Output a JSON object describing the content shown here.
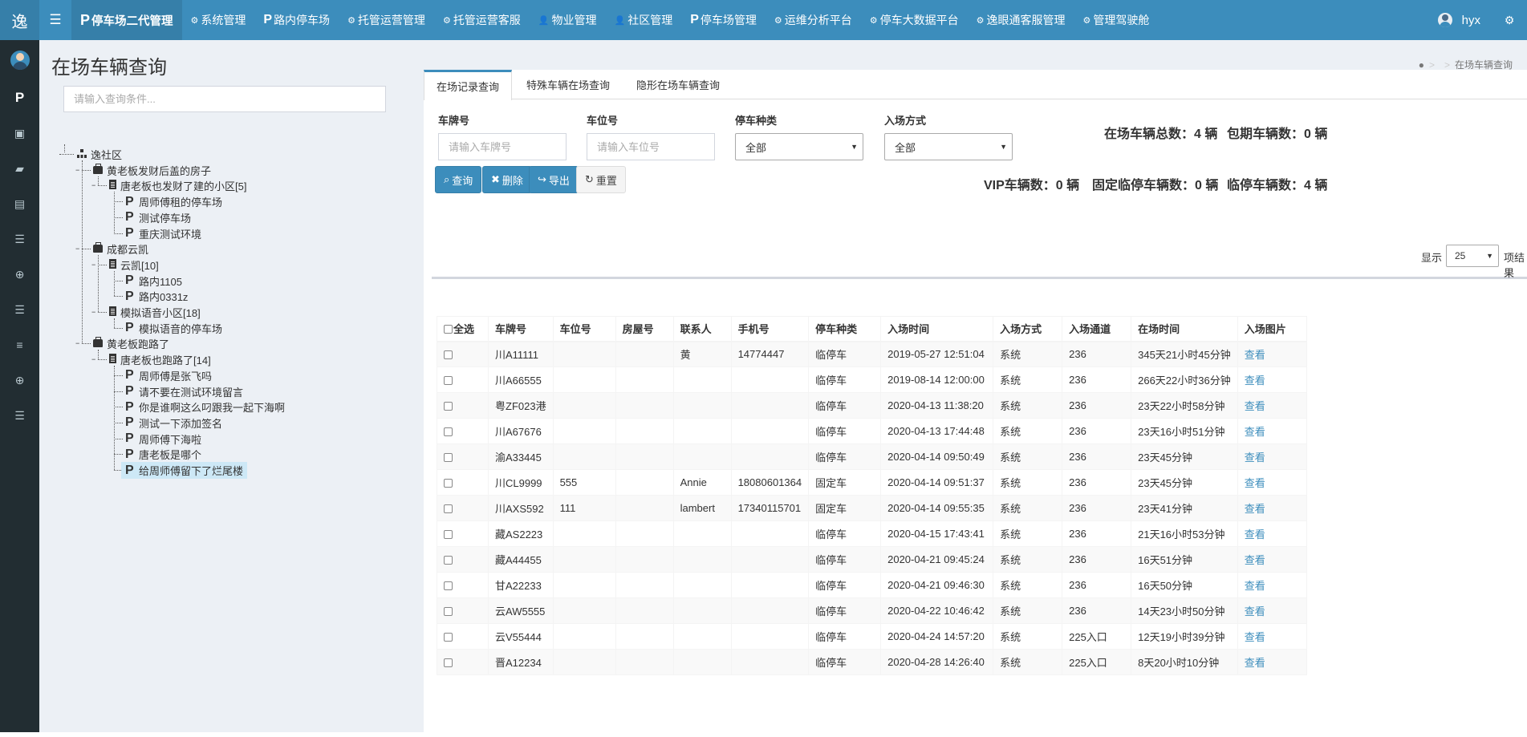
{
  "app": {
    "logo": "逸"
  },
  "nav": {
    "items": [
      {
        "glyph": "P",
        "label": "停车场二代管理",
        "active": true
      },
      {
        "icon": "cogs-icon",
        "label": "系统管理"
      },
      {
        "glyph": "P",
        "label": "路内停车场"
      },
      {
        "icon": "cogs-icon",
        "label": "托管运营管理"
      },
      {
        "icon": "cogs-icon",
        "label": "托管运营客服"
      },
      {
        "icon": "user-icon",
        "label": "物业管理"
      },
      {
        "icon": "user-icon",
        "label": "社区管理"
      },
      {
        "glyph": "P",
        "label": "停车场管理"
      },
      {
        "icon": "cogs-icon",
        "label": "运维分析平台"
      },
      {
        "icon": "cogs-icon",
        "label": "停车大数据平台"
      },
      {
        "icon": "cogs-icon",
        "label": "逸眼通客服管理"
      },
      {
        "icon": "cogs-icon",
        "label": "管理驾驶舱"
      }
    ],
    "user": "hyx"
  },
  "sidebar": {
    "items": [
      "user-avatar",
      "parking-icon",
      "comments-icon",
      "car-icon",
      "book-icon",
      "list-icon",
      "search-plus-icon",
      "list-icon",
      "bars-icon",
      "search-plus-icon",
      "list-icon"
    ]
  },
  "page": {
    "title": "在场车辆查询",
    "breadcrumb_sep": ">",
    "breadcrumb_current": "在场车辆查询"
  },
  "tree": {
    "search_placeholder": "请输入查询条件...",
    "nodes": [
      {
        "label": "逸社区",
        "icon": "sitemap-icon",
        "level": 0
      },
      {
        "label": "黄老板发财后盖的房子",
        "icon": "briefcase-icon",
        "level": 1
      },
      {
        "label": "唐老板也发财了建的小区[5]",
        "icon": "building-icon",
        "level": 2
      },
      {
        "label": "周师傅租的停车场",
        "icon": "parking-icon",
        "level": 3
      },
      {
        "label": "测试停车场",
        "icon": "parking-icon",
        "level": 3
      },
      {
        "label": "重庆测试环境",
        "icon": "parking-icon",
        "level": 3
      },
      {
        "label": "成都云凯",
        "icon": "briefcase-icon",
        "level": 1
      },
      {
        "label": "云凯[10]",
        "icon": "building-icon",
        "level": 2
      },
      {
        "label": "路内1105",
        "icon": "parking-icon",
        "level": 3
      },
      {
        "label": "路内0331z",
        "icon": "parking-icon",
        "level": 3
      },
      {
        "label": "模拟语音小区[18]",
        "icon": "building-icon",
        "level": 2
      },
      {
        "label": "模拟语音的停车场",
        "icon": "parking-icon",
        "level": 3
      },
      {
        "label": "黄老板跑路了",
        "icon": "briefcase-icon",
        "level": 1
      },
      {
        "label": "唐老板也跑路了[14]",
        "icon": "building-icon",
        "level": 2
      },
      {
        "label": "周师傅是张飞吗",
        "icon": "parking-icon",
        "level": 3
      },
      {
        "label": "请不要在测试环境留言",
        "icon": "parking-icon",
        "level": 3
      },
      {
        "label": "你是谁啊这么叼跟我一起下海啊",
        "icon": "parking-icon",
        "level": 3
      },
      {
        "label": "测试一下添加签名",
        "icon": "parking-icon",
        "level": 3
      },
      {
        "label": "周师傅下海啦",
        "icon": "parking-icon",
        "level": 3
      },
      {
        "label": "唐老板是哪个",
        "icon": "parking-icon",
        "level": 3
      },
      {
        "label": "给周师傅留下了烂尾楼",
        "icon": "parking-icon",
        "level": 3,
        "selected": true
      }
    ]
  },
  "tabs": [
    "在场记录查询",
    "特殊车辆在场查询",
    "隐形在场车辆查询"
  ],
  "filters": {
    "plate_label": "车牌号",
    "plate_placeholder": "请输入车牌号",
    "space_label": "车位号",
    "space_placeholder": "请输入车位号",
    "type_label": "停车种类",
    "type_value": "全部",
    "entry_label": "入场方式",
    "entry_value": "全部"
  },
  "stats": {
    "total": "在场车辆总数：4 辆",
    "monthly": "包期车辆数：0 辆",
    "vip": "VIP车辆数：0 辆",
    "fixed_temp": "固定临停车辆数：0 辆",
    "temp": "临停车辆数：4 辆"
  },
  "buttons": {
    "query": "查询",
    "delete": "删除",
    "export": "导出",
    "reset": "重置"
  },
  "pagination": {
    "show": "显示",
    "size": "25",
    "suffix": "项结果"
  },
  "table": {
    "select_all": "全选",
    "columns": [
      "车牌号",
      "车位号",
      "房屋号",
      "联系人",
      "手机号",
      "停车种类",
      "入场时间",
      "入场方式",
      "入场通道",
      "在场时间",
      "入场图片"
    ],
    "rows": [
      [
        "川A11111",
        "",
        "",
        "黄",
        "14774447",
        "临停车",
        "2019-05-27 12:51:04",
        "系统",
        "236",
        "345天21小时45分钟",
        "查看"
      ],
      [
        "川A66555",
        "",
        "",
        "",
        "",
        "临停车",
        "2019-08-14 12:00:00",
        "系统",
        "236",
        "266天22小时36分钟",
        "查看"
      ],
      [
        "粤ZF023港",
        "",
        "",
        "",
        "",
        "临停车",
        "2020-04-13 11:38:20",
        "系统",
        "236",
        "23天22小时58分钟",
        "查看"
      ],
      [
        "川A67676",
        "",
        "",
        "",
        "",
        "临停车",
        "2020-04-13 17:44:48",
        "系统",
        "236",
        "23天16小时51分钟",
        "查看"
      ],
      [
        "渝A33445",
        "",
        "",
        "",
        "",
        "临停车",
        "2020-04-14 09:50:49",
        "系统",
        "236",
        "23天45分钟",
        "查看"
      ],
      [
        "川CL9999",
        "555",
        "",
        "Annie",
        "18080601364",
        "固定车",
        "2020-04-14 09:51:37",
        "系统",
        "236",
        "23天45分钟",
        "查看"
      ],
      [
        "川AXS592",
        "111",
        "",
        "lambert",
        "17340115701",
        "固定车",
        "2020-04-14 09:55:35",
        "系统",
        "236",
        "23天41分钟",
        "查看"
      ],
      [
        "藏AS2223",
        "",
        "",
        "",
        "",
        "临停车",
        "2020-04-15 17:43:41",
        "系统",
        "236",
        "21天16小时53分钟",
        "查看"
      ],
      [
        "藏A44455",
        "",
        "",
        "",
        "",
        "临停车",
        "2020-04-21 09:45:24",
        "系统",
        "236",
        "16天51分钟",
        "查看"
      ],
      [
        "甘A22233",
        "",
        "",
        "",
        "",
        "临停车",
        "2020-04-21 09:46:30",
        "系统",
        "236",
        "16天50分钟",
        "查看"
      ],
      [
        "云AW5555",
        "",
        "",
        "",
        "",
        "临停车",
        "2020-04-22 10:46:42",
        "系统",
        "236",
        "14天23小时50分钟",
        "查看"
      ],
      [
        "云V55444",
        "",
        "",
        "",
        "",
        "临停车",
        "2020-04-24 14:57:20",
        "系统",
        "225入口",
        "12天19小时39分钟",
        "查看"
      ],
      [
        "晋A12234",
        "",
        "",
        "",
        "",
        "临停车",
        "2020-04-28 14:26:40",
        "系统",
        "225入口",
        "8天20小时10分钟",
        "查看"
      ]
    ]
  }
}
